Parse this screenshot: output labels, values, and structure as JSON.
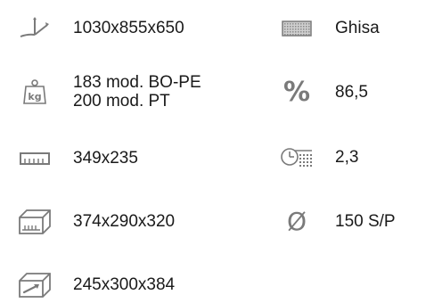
{
  "specs": {
    "dimensions": {
      "icon": "ground-dimensions-icon",
      "value": "1030x855x650"
    },
    "weight": {
      "icon": "kg-weight-icon",
      "line1": "183 mod. BO-PE",
      "line2": "200 mod. PT"
    },
    "grate": {
      "icon": "ruler-icon",
      "value": "349x235"
    },
    "firebox": {
      "icon": "firebox-volume-icon",
      "value": "374x290x320"
    },
    "ashpan": {
      "icon": "ash-drawer-icon",
      "value": "245x300x384"
    },
    "material": {
      "icon": "cast-iron-texture-icon",
      "value": "Ghisa"
    },
    "efficiency": {
      "icon": "percent-icon",
      "symbol": "%",
      "value": "86,5"
    },
    "consumption": {
      "icon": "clock-meter-icon",
      "value": "2,3"
    },
    "flue": {
      "icon": "diameter-icon",
      "symbol": "Ø",
      "value": "150 S/P"
    }
  },
  "colors": {
    "icon_gray": "#7a7a7a",
    "text": "#1a1a1a"
  }
}
